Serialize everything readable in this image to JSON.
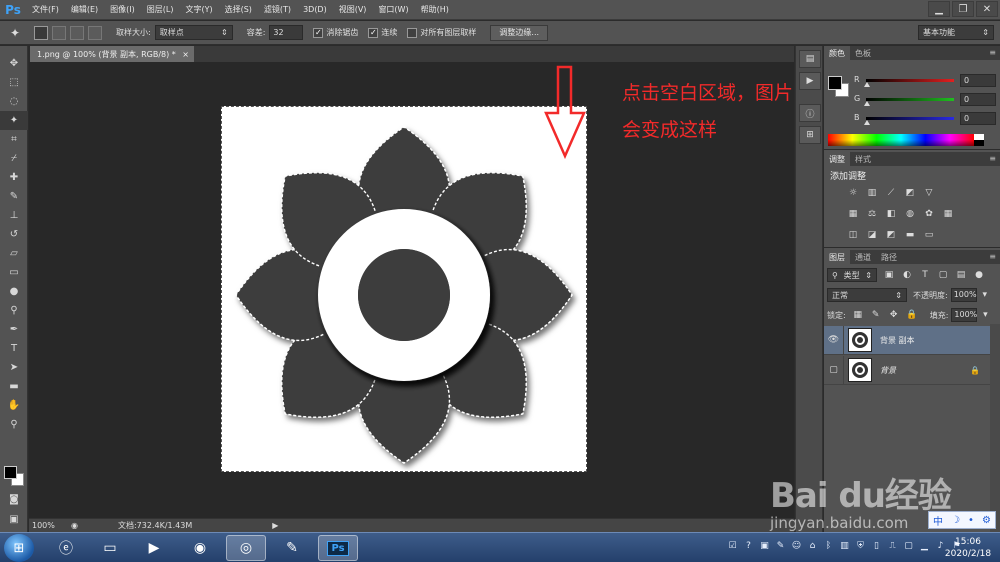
{
  "menubar": {
    "logo": "Ps",
    "items": [
      "文件(F)",
      "编辑(E)",
      "图像(I)",
      "图层(L)",
      "文字(Y)",
      "选择(S)",
      "滤镜(T)",
      "3D(D)",
      "视图(V)",
      "窗口(W)",
      "帮助(H)"
    ],
    "window_controls": [
      "▁",
      "❐",
      "✕"
    ]
  },
  "options": {
    "sample_size_label": "取样大小:",
    "sample_size_value": "取样点",
    "tolerance_label": "容差:",
    "tolerance_value": "32",
    "anti_alias_label": "消除锯齿",
    "contiguous_label": "连续",
    "all_layers_label": "对所有图层取样",
    "refine_edge_button": "调整边缘...",
    "workspace": "基本功能"
  },
  "document": {
    "tab_title": "1.png @ 100% (背景 副本, RGB/8) *",
    "tab_close": "×",
    "zoom": "100%",
    "doc_info": "文档:732.4K/1.43M"
  },
  "annotation": {
    "text": "点击空白区域，图片会变成这样",
    "color": "#f22a2a"
  },
  "color_panel": {
    "tabs": [
      "颜色",
      "色板"
    ],
    "sliders": [
      {
        "label": "R",
        "value": "0",
        "color": "#e31f1f"
      },
      {
        "label": "G",
        "value": "0",
        "color": "#1fbf1f"
      },
      {
        "label": "B",
        "value": "0",
        "color": "#2a2ae3"
      }
    ]
  },
  "adjust_panel": {
    "tabs": [
      "调整",
      "样式"
    ],
    "title": "添加调整"
  },
  "layers_panel": {
    "tabs": [
      "图层",
      "通道",
      "路径"
    ],
    "filter_kind": "类型",
    "blend_mode": "正常",
    "opacity_label": "不透明度:",
    "opacity_value": "100%",
    "lock_label": "锁定:",
    "fill_label": "填充:",
    "fill_value": "100%",
    "layers": [
      {
        "name": "背景 副本",
        "visible": true,
        "selected": true,
        "locked": false
      },
      {
        "name": "背景",
        "visible": false,
        "selected": false,
        "locked": true
      }
    ]
  },
  "watermark": {
    "logo": "Bai du经验",
    "url": "jingyan.baidu.com"
  },
  "ime": {
    "items": [
      "中",
      "☽",
      "•",
      "⚙"
    ]
  },
  "taskbar": {
    "start_icon": "windows-logo",
    "time": "15:06",
    "date": "2020/2/18",
    "ps_label": "Ps"
  }
}
